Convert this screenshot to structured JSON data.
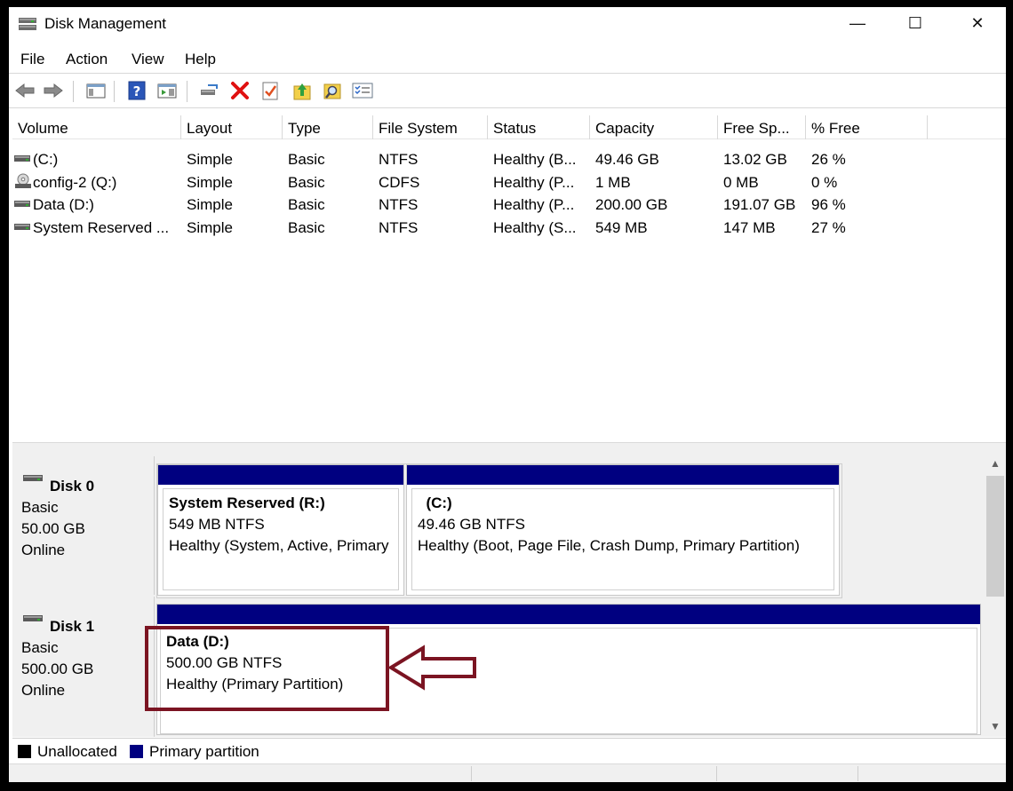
{
  "window": {
    "title": "Disk Management",
    "minimize_glyph": "—",
    "maximize_glyph": "☐",
    "close_glyph": "✕"
  },
  "menu": [
    "File",
    "Action",
    "View",
    "Help"
  ],
  "toolbar_icons": [
    "back-icon",
    "forward-icon",
    "console-tree-icon",
    "help-icon",
    "action-pane-icon",
    "connect-disk-icon",
    "delete-icon",
    "properties-icon",
    "up-icon",
    "find-icon",
    "list-icon"
  ],
  "volume_list": {
    "columns": [
      "Volume",
      "Layout",
      "Type",
      "File System",
      "Status",
      "Capacity",
      "Free Sp...",
      "% Free"
    ],
    "rows": [
      {
        "icon": "drive-icon",
        "volume": " (C:)",
        "layout": "Simple",
        "type": "Basic",
        "fs": "NTFS",
        "status": "Healthy (B...",
        "capacity": "49.46 GB",
        "free": "13.02 GB",
        "pct": "26 %"
      },
      {
        "icon": "cd-drive-icon",
        "volume": "config-2 (Q:)",
        "layout": "Simple",
        "type": "Basic",
        "fs": "CDFS",
        "status": "Healthy (P...",
        "capacity": "1 MB",
        "free": "0 MB",
        "pct": "0 %"
      },
      {
        "icon": "drive-icon",
        "volume": "Data (D:)",
        "layout": "Simple",
        "type": "Basic",
        "fs": "NTFS",
        "status": "Healthy (P...",
        "capacity": "200.00 GB",
        "free": "191.07 GB",
        "pct": "96 %"
      },
      {
        "icon": "drive-icon",
        "volume": "System Reserved ...",
        "layout": "Simple",
        "type": "Basic",
        "fs": "NTFS",
        "status": "Healthy (S...",
        "capacity": "549 MB",
        "free": "147 MB",
        "pct": "27 %"
      }
    ]
  },
  "disks": [
    {
      "name": "Disk 0",
      "kind": "Basic",
      "size": "50.00 GB",
      "state": "Online",
      "partitions": [
        {
          "title": "System Reserved  (R:)",
          "detail": "549 MB NTFS",
          "status": "Healthy (System, Active, Primary"
        },
        {
          "title": "  (C:)",
          "detail": "49.46 GB NTFS",
          "status": "Healthy (Boot, Page File, Crash Dump, Primary Partition)"
        }
      ]
    },
    {
      "name": "Disk 1",
      "kind": "Basic",
      "size": "500.00 GB",
      "state": "Online",
      "partitions": [
        {
          "title": "Data  (D:)",
          "detail": "500.00 GB NTFS",
          "status": "Healthy (Primary Partition)"
        }
      ]
    }
  ],
  "legend": [
    {
      "label": "Unallocated",
      "color": "#000000"
    },
    {
      "label": "Primary partition",
      "color": "#000080"
    }
  ],
  "colors": {
    "partition_bar": "#000080",
    "annotation": "#7b1422"
  }
}
